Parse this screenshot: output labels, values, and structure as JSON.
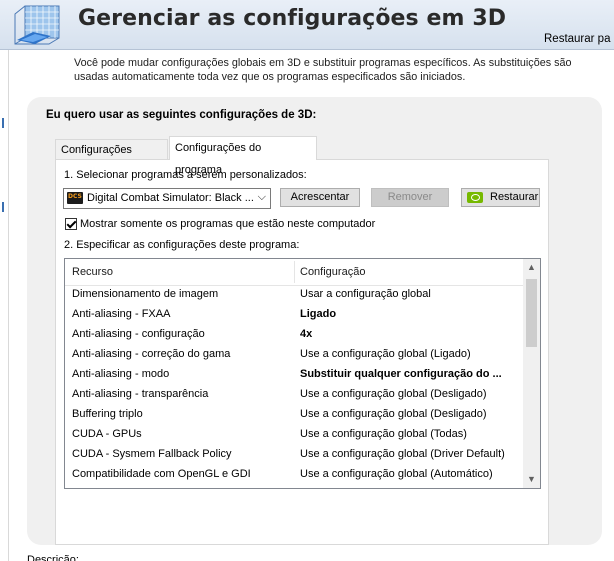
{
  "header": {
    "title": "Gerenciar as configurações em 3D",
    "restore_link": "Restaurar pa"
  },
  "description": "Você pode mudar configurações globais em 3D e substituir programas específicos. As substituições são usadas automaticamente toda vez que os programas especificados são iniciados.",
  "panel": {
    "heading": "Eu quero usar as seguintes configurações de 3D:",
    "tabs": [
      {
        "label": "Configurações globais",
        "active": false
      },
      {
        "label": "Configurações do programa",
        "active": true
      }
    ]
  },
  "program_section": {
    "step1_label": "1. Selecionar programas a serem personalizados:",
    "selected_program": "Digital Combat Simulator: Black ...",
    "program_icon": "dcs-icon",
    "buttons": {
      "add": "Acrescentar",
      "remove": "Remover",
      "restore": "Restaurar"
    },
    "checkbox_label": "Mostrar somente os programas que estão neste computador",
    "checkbox_checked": true,
    "step2_label": "2. Especificar as configurações deste programa:"
  },
  "settings_table": {
    "columns": [
      "Recurso",
      "Configuração"
    ],
    "rows": [
      {
        "feature": "Dimensionamento de imagem",
        "setting": "Usar a configuração global",
        "bold": false
      },
      {
        "feature": "Anti-aliasing - FXAA",
        "setting": "Ligado",
        "bold": true
      },
      {
        "feature": "Anti-aliasing - configuração",
        "setting": "4x",
        "bold": true
      },
      {
        "feature": "Anti-aliasing - correção do gama",
        "setting": "Use a configuração global (Ligado)",
        "bold": false
      },
      {
        "feature": "Anti-aliasing - modo",
        "setting": "Substituir qualquer configuração do ...",
        "bold": true
      },
      {
        "feature": "Anti-aliasing - transparência",
        "setting": "Use a configuração global (Desligado)",
        "bold": false
      },
      {
        "feature": "Buffering triplo",
        "setting": "Use a configuração global (Desligado)",
        "bold": false
      },
      {
        "feature": "CUDA - GPUs",
        "setting": "Use a configuração global (Todas)",
        "bold": false
      },
      {
        "feature": "CUDA - Sysmem Fallback Policy",
        "setting": "Use a configuração global (Driver Default)",
        "bold": false
      },
      {
        "feature": "Compatibilidade com OpenGL e GDI",
        "setting": "Use a configuração global (Automático)",
        "bold": false
      }
    ]
  },
  "footer_text": "Descrição:",
  "colors": {
    "header_bg": "#dde6f1",
    "panel_bg": "#f0f0f0",
    "nvidia_green": "#76b900"
  }
}
